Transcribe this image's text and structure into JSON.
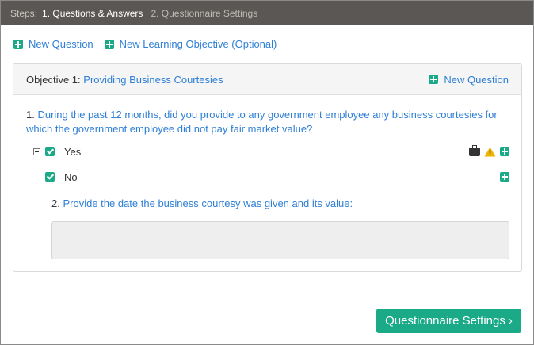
{
  "steps": {
    "label": "Steps:",
    "step1": "1. Questions & Answers",
    "step2": "2. Questionnaire Settings"
  },
  "top_actions": {
    "new_question": "New Question",
    "new_objective": "New Learning Objective (Optional)"
  },
  "objective": {
    "prefix": "Objective 1:",
    "name": "Providing Business Courtesies",
    "new_question": "New Question"
  },
  "question": {
    "number": "1.",
    "text": "During the past 12 months, did you provide to any government employee any business courtesies for which the government employee did not pay fair market value?"
  },
  "answers": [
    {
      "label": "Yes",
      "checked": true
    },
    {
      "label": "No",
      "checked": true
    }
  ],
  "subquestion": {
    "number": "2.",
    "text": "Provide the date the business courtesy was given and its value:"
  },
  "answer_box_value": "",
  "footer": {
    "settings_button": "Questionnaire Settings",
    "settings_chevron": "›"
  },
  "colors": {
    "accent": "#1aaa88",
    "link": "#2f7fd6",
    "header_bar": "#5b5754",
    "warning": "#f0b400"
  },
  "icons": [
    "plus-icon",
    "collapse-icon",
    "checkbox-icon",
    "briefcase-icon",
    "warning-icon",
    "chevron-right-icon"
  ]
}
